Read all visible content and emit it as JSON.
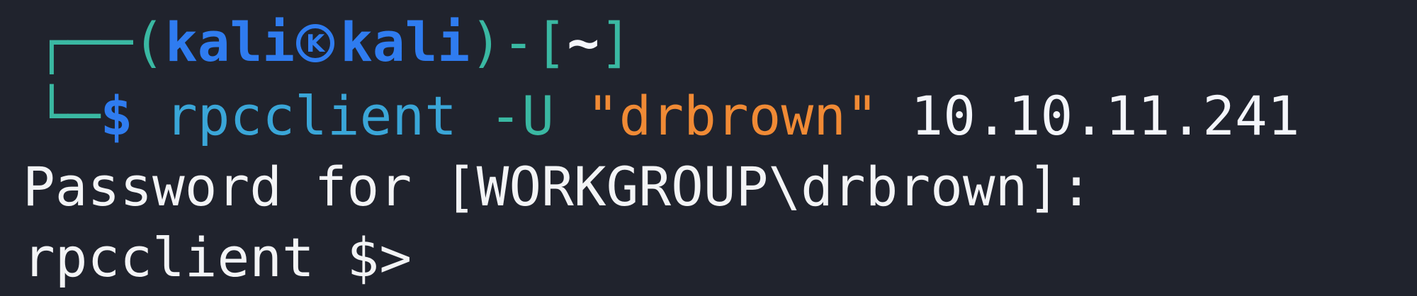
{
  "prompt_header": {
    "frame_start": "┌──(",
    "user": "kali",
    "icon": "kali-logo-icon",
    "host": "kali",
    "frame_mid": ")-[",
    "dir": "~",
    "frame_end": "]"
  },
  "prompt_line": {
    "frame": "└─",
    "symbol": "$",
    "command": "rpcclient",
    "flag": "-U",
    "user_arg": "\"drbrown\"",
    "ip_arg": "10.10.11.241"
  },
  "output": {
    "password_prompt": "Password for [WORKGROUP\\drbrown]:",
    "rpc_prompt": "rpcclient $>"
  },
  "colors": {
    "background": "#20232d",
    "frame": "#3ab8a2",
    "prompt_blue": "#2f7cf0",
    "command": "#3aa6d8",
    "string": "#f08a35",
    "text": "#f3f4f6"
  }
}
